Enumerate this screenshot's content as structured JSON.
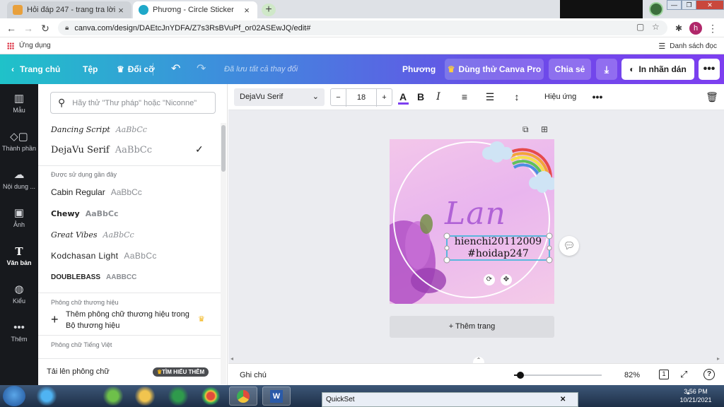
{
  "browser": {
    "tabs": [
      {
        "title": "Hỏi đáp 247 - trang tra lời",
        "close": "×"
      },
      {
        "title": "Phương - Circle Sticker",
        "close": "×"
      }
    ],
    "new_tab": "+",
    "url": "canva.com/design/DAEtcJnYDFA/Z7s3RsBVuPf_or02ASEwJQ/edit#",
    "profile_initial": "h",
    "bookmarks": {
      "apps_label": "Ứng dụng",
      "reading_list": "Danh sách đọc"
    }
  },
  "canva_header": {
    "back_label": "Trang chủ",
    "file_label": "Tệp",
    "resize_label": "Đổi cỡ",
    "saved_status": "Đã lưu tất cả thay đổi",
    "user_name": "Phương",
    "try_pro": "Dùng thử Canva Pro",
    "share": "Chia sẻ",
    "print": "In nhãn dán",
    "more": "•••"
  },
  "rail": [
    {
      "label": "Mẫu",
      "icon": "template-icon"
    },
    {
      "label": "Thành phần",
      "icon": "elements-icon"
    },
    {
      "label": "Nội dung ...",
      "icon": "upload-cloud-icon"
    },
    {
      "label": "Ảnh",
      "icon": "photo-icon"
    },
    {
      "label": "Văn bản",
      "icon": "text-icon"
    },
    {
      "label": "Kiểu",
      "icon": "palette-icon"
    },
    {
      "label": "Thêm",
      "icon": "more-icon"
    }
  ],
  "font_panel": {
    "search_placeholder": "Hãy thử \"Thư pháp\" hoặc \"Niconne\"",
    "top_fonts": [
      {
        "name": "Dancing Script",
        "sample": "AaBbCc"
      },
      {
        "name": "DejaVu Serif",
        "sample": "AaBbCc",
        "selected": true
      }
    ],
    "recent_heading": "Được sử dụng gần đây",
    "recent": [
      {
        "name": "Cabin Regular",
        "sample": "AaBbCc"
      },
      {
        "name": "Chewy",
        "sample": "AaBbCc"
      },
      {
        "name": "Great Vibes",
        "sample": "AaBbCc"
      },
      {
        "name": "Kodchasan Light",
        "sample": "AaBbCc"
      },
      {
        "name": "DOUBLEBASS",
        "sample": "AABBCC"
      }
    ],
    "brand_heading": "Phông chữ thương hiệu",
    "brand_add": "Thêm phông chữ thương hiệu trong Bộ thương hiệu",
    "vn_heading": "Phông chữ Tiếng Việt",
    "upload_label": "Tải lên phông chữ",
    "learn_more": "TÌM HIỂU THÊM"
  },
  "toolbar": {
    "font": "DejaVu Serif",
    "size": "18",
    "effects": "Hiệu ứng"
  },
  "design": {
    "title_text": "Lan",
    "line1": "hienchi20112009",
    "line2": "#hoidap247",
    "add_page": "+ Thêm trang"
  },
  "bottom": {
    "notes": "Ghi chú",
    "zoom": "82%",
    "zoom_level": 0.07,
    "page_count": "1"
  },
  "taskbar": {
    "quickset": "QuickSet",
    "time": "3:56 PM",
    "date": "10/21/2021"
  },
  "colors": {
    "accent": "#7d3ff0",
    "teal": "#1fc2c9",
    "text_color_bar": "#7d3ff0"
  }
}
